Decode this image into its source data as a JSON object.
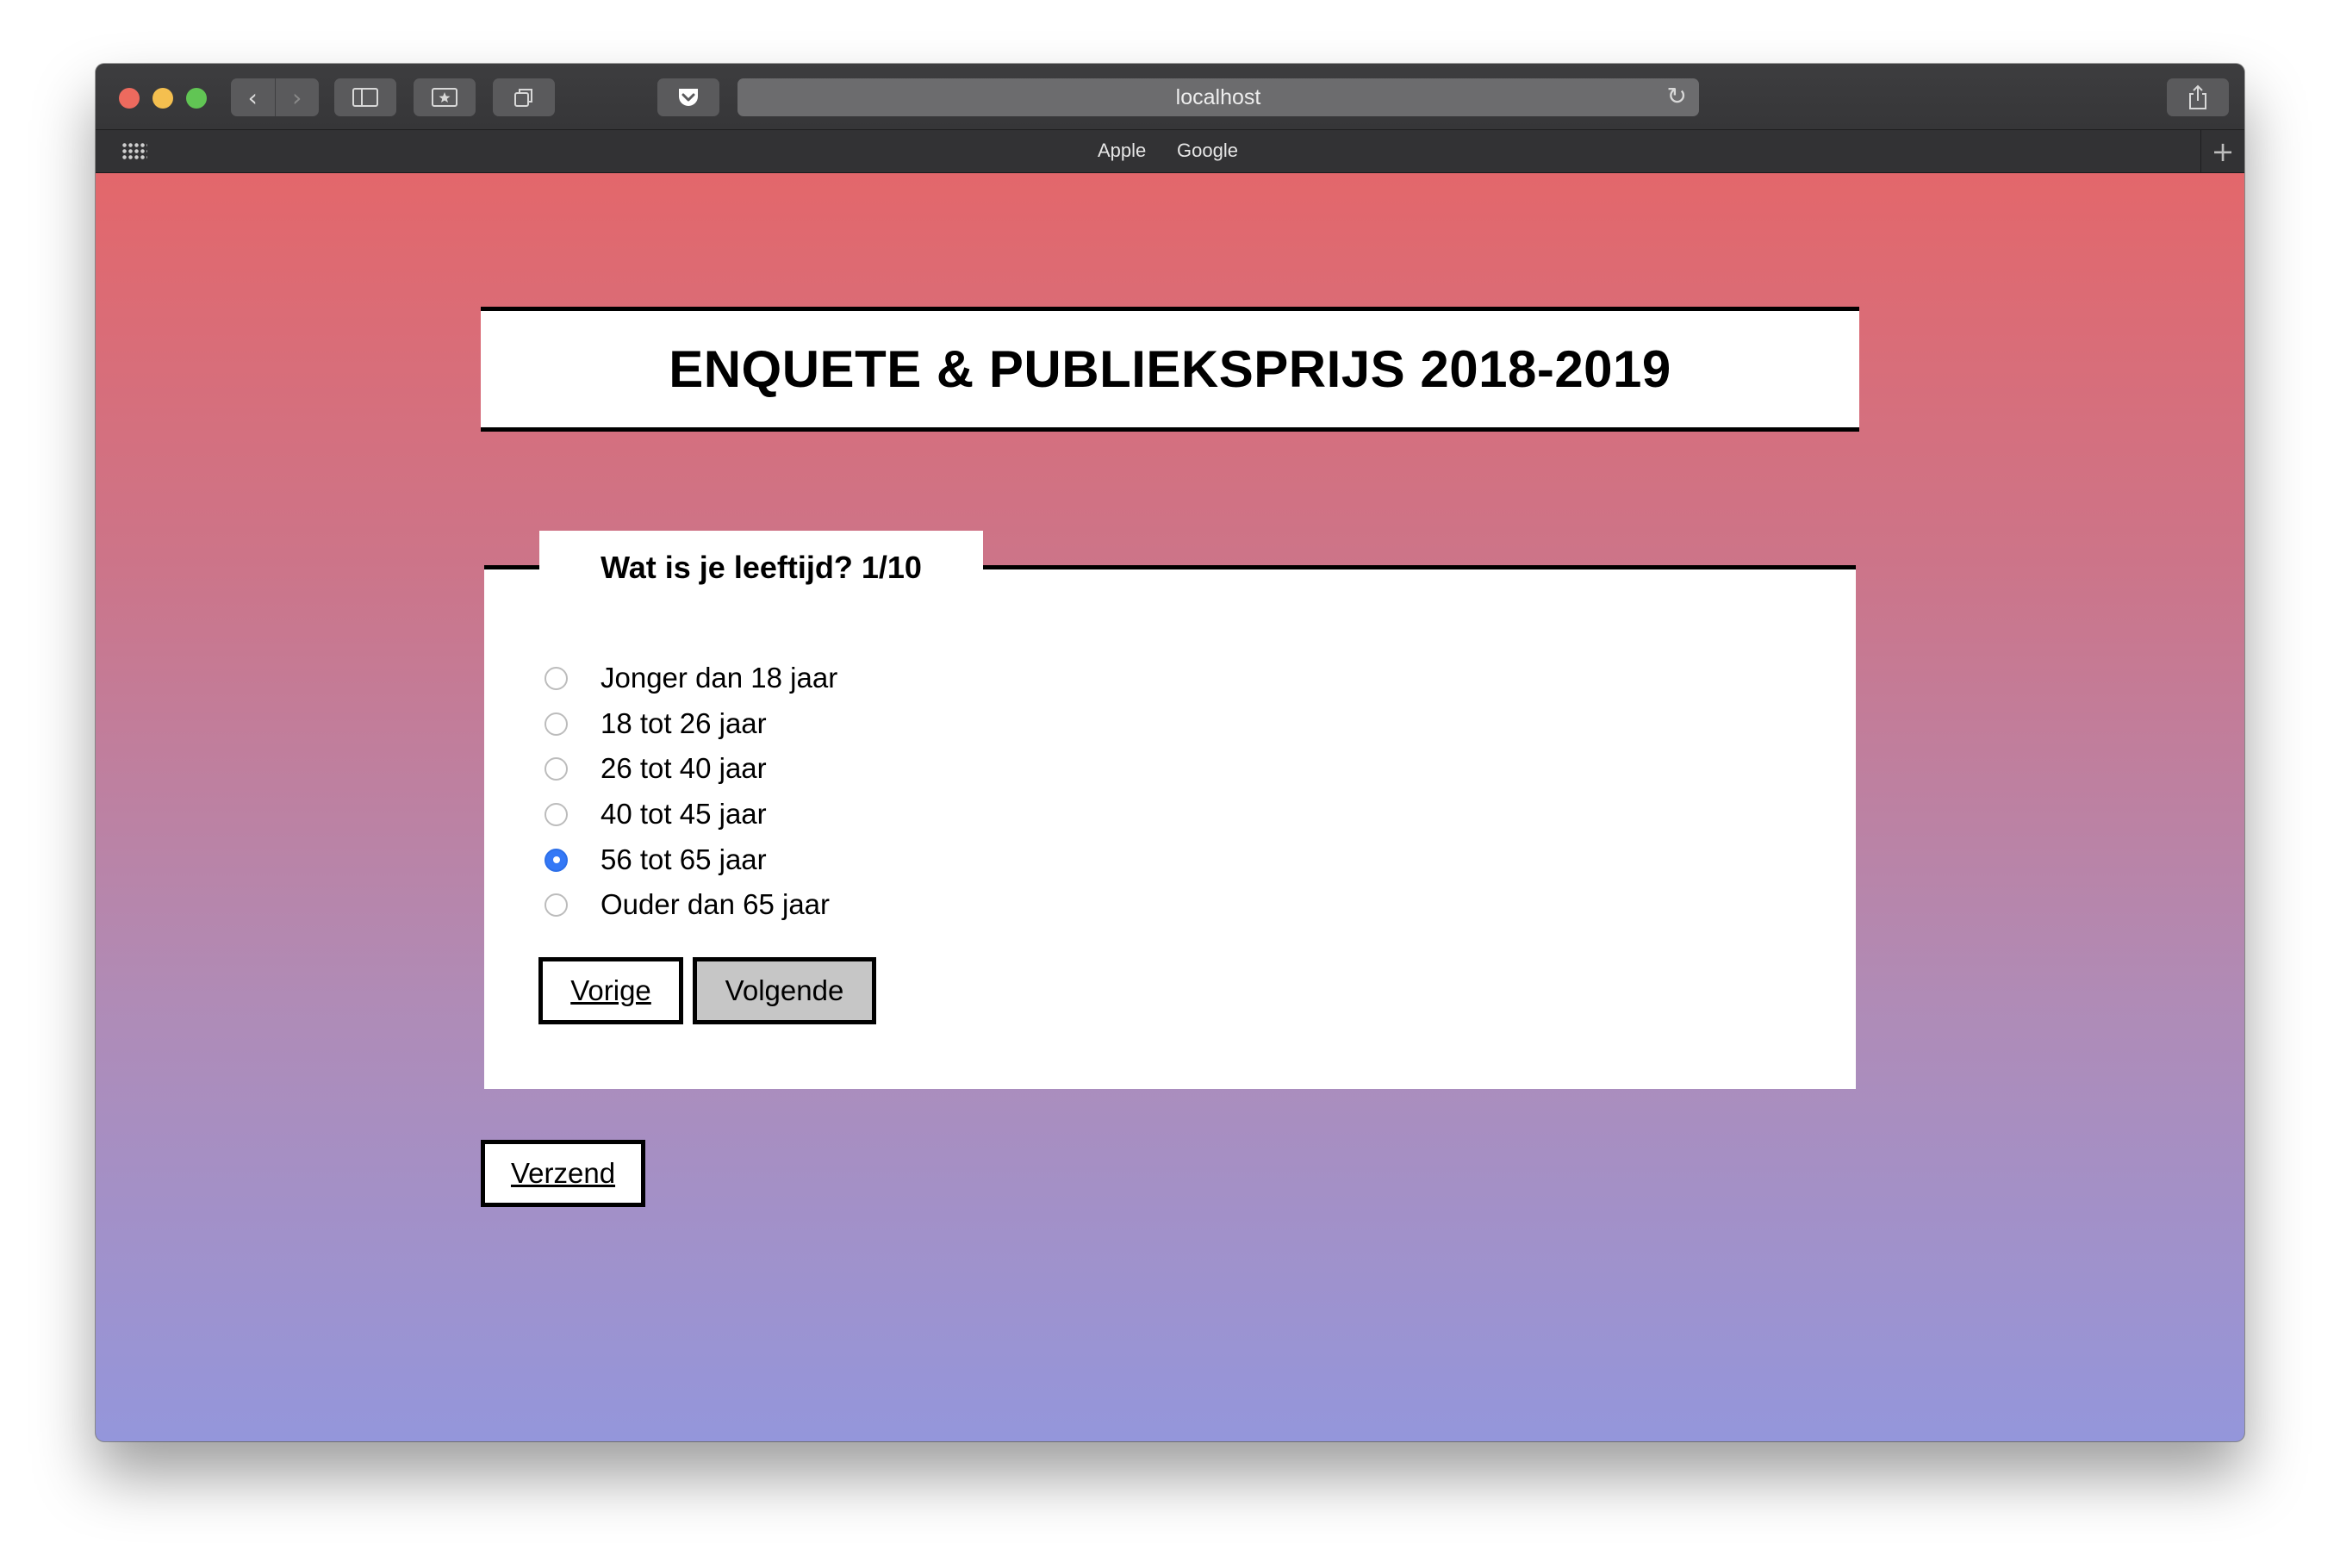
{
  "browser": {
    "url": "localhost",
    "favorites": [
      "Apple",
      "Google"
    ],
    "nav_back_icon": "chevron-left-icon",
    "nav_forward_icon": "chevron-right-icon"
  },
  "page": {
    "title": "ENQUETE & PUBLIEKSPRIJS 2018-2019",
    "question": "Wat is je leeftijd? 1/10",
    "options": [
      {
        "label": "Jonger dan 18 jaar",
        "checked": false
      },
      {
        "label": "18 tot 26 jaar",
        "checked": false
      },
      {
        "label": "26 tot 40 jaar",
        "checked": false
      },
      {
        "label": "40 tot 45 jaar",
        "checked": false
      },
      {
        "label": "56 tot 65 jaar",
        "checked": true
      },
      {
        "label": "Ouder dan 65 jaar",
        "checked": false
      }
    ],
    "buttons": {
      "previous": "Vorige",
      "next": "Volgende",
      "submit": "Verzend"
    }
  },
  "colors": {
    "gradient_top": "#e3676b",
    "gradient_bottom": "#9496db",
    "radio_checked": "#3478f6"
  }
}
